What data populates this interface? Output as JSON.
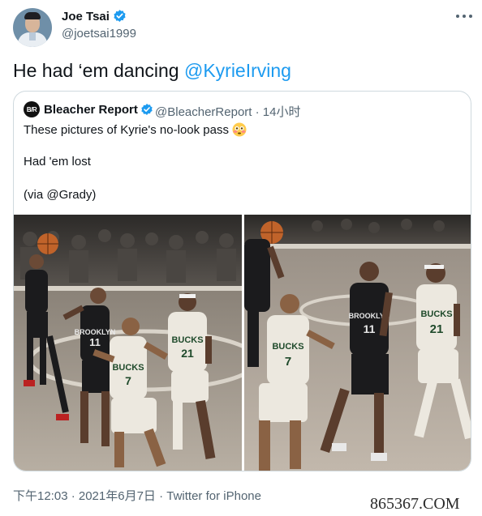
{
  "author": {
    "name": "Joe Tsai",
    "handle": "@joetsai1999"
  },
  "tweet": {
    "text": "He had ‘em dancing ",
    "mention": "@KyrieIrving"
  },
  "quoted_tweet": {
    "avatar_text": "B/R",
    "name": "Bleacher Report",
    "handle_time": "@BleacherReport · 14小时",
    "line1": "These pictures of Kyrie's no-look pass",
    "line2": "Had 'em lost",
    "line3": "(via @Grady)",
    "photo1": {
      "jersey_a_text": "BROOKLYN",
      "jersey_a_number": "11",
      "jersey_b_text": "BUCKS",
      "jersey_b_number": "7",
      "jersey_c_text": "BUCKS",
      "jersey_c_number": "21"
    },
    "photo2": {
      "jersey_a_text": "BROOKLYN",
      "jersey_a_number": "11",
      "jersey_b_text": "BUCKS",
      "jersey_b_number": "7",
      "jersey_c_text": "BUCKS",
      "jersey_c_number": "21"
    }
  },
  "meta": {
    "timestamp": "下午12:03 · 2021年6月7日 · Twitter for iPhone"
  },
  "watermark": {
    "text": "865367.COM"
  },
  "icons": {
    "verified": "verified-badge-icon",
    "more": "more-horizontal-icon",
    "emoji": "flushed-face-emoji"
  },
  "colors": {
    "accent": "#1d9bf0",
    "secondary_text": "#536471",
    "border": "#cfd9de"
  }
}
